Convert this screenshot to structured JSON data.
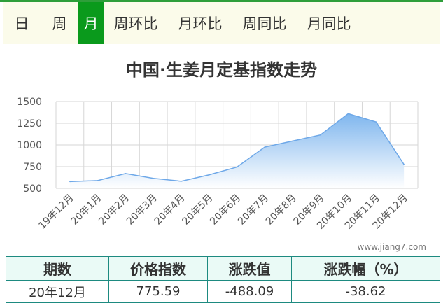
{
  "tabs": [
    {
      "label": "日",
      "active": false
    },
    {
      "label": "周",
      "active": false
    },
    {
      "label": "月",
      "active": true
    },
    {
      "label": "周环比",
      "active": false
    },
    {
      "label": "月环比",
      "active": false
    },
    {
      "label": "周同比",
      "active": false
    },
    {
      "label": "月同比",
      "active": false
    }
  ],
  "chart_data": {
    "type": "area",
    "title": "中国·生姜月定基指数走势",
    "categories": [
      "19年12月",
      "20年1月",
      "20年2月",
      "20年3月",
      "20年4月",
      "20年5月",
      "20年6月",
      "20年7月",
      "20年8月",
      "20年9月",
      "20年10月",
      "20年11月",
      "20年12月"
    ],
    "series": [
      {
        "values": [
          578,
          590,
          670,
          615,
          582,
          655,
          745,
          975,
          1045,
          1115,
          1360,
          1265,
          776
        ]
      }
    ],
    "yticks": [
      500,
      750,
      1000,
      1250,
      1500
    ],
    "ylim": [
      500,
      1500
    ],
    "grid": true,
    "colors": {
      "line": "#6ea8e8",
      "fill_top": "#7fb6ee",
      "fill_bottom": "#ffffff"
    }
  },
  "watermark": "www.jiang7.com",
  "table": {
    "headers": [
      "期数",
      "价格指数",
      "涨跌值",
      "涨跌幅（%）"
    ],
    "row": [
      "20年12月",
      "775.59",
      "-488.09",
      "-38.62"
    ]
  }
}
